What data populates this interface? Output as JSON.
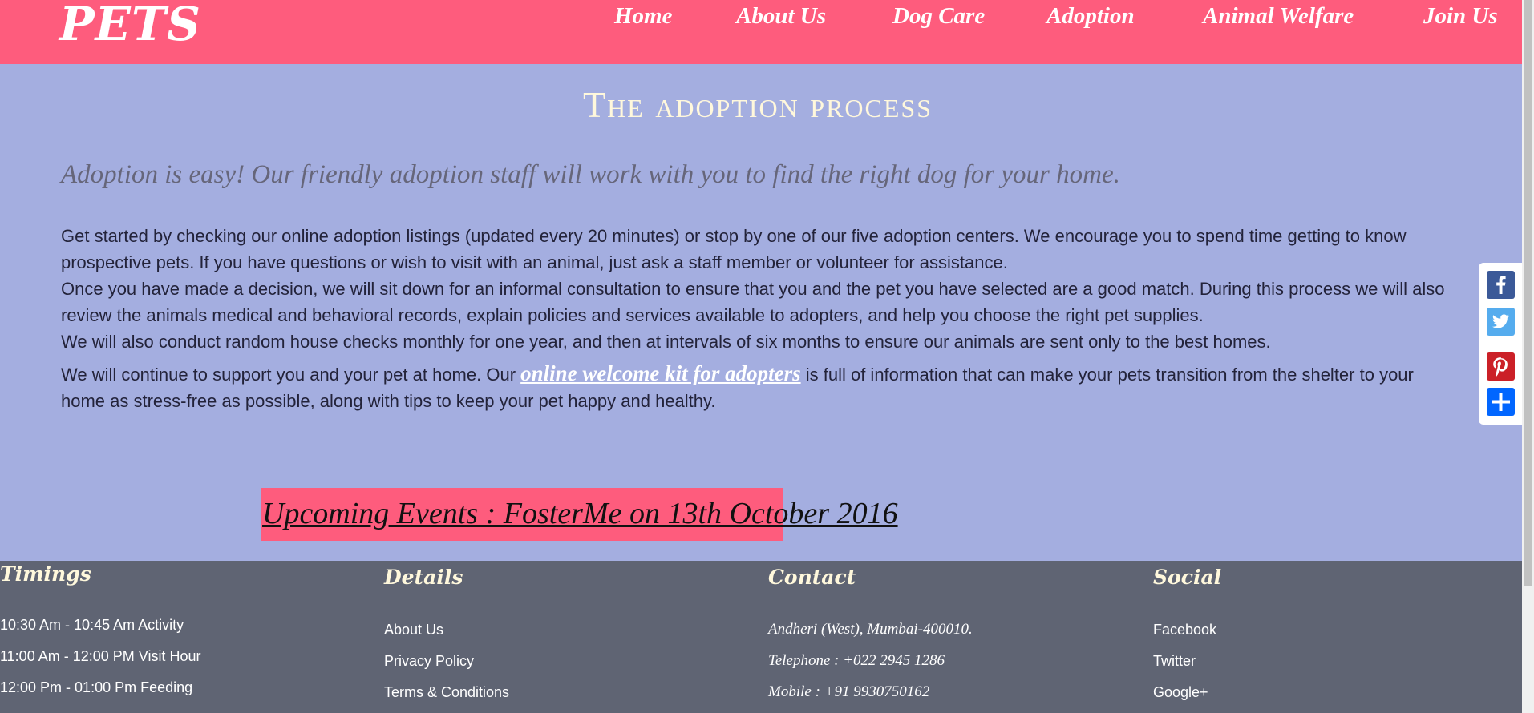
{
  "header": {
    "logo": "PETS",
    "nav": [
      "Home",
      "About Us",
      "Dog Care",
      "Adoption",
      "Animal Welfare",
      "Join Us"
    ]
  },
  "main": {
    "title": "The adoption process",
    "lead": "Adoption is easy! Our friendly adoption staff will work with you to find the right dog for your home.",
    "para1_line1": "Get started by checking our online adoption listings (updated every 20 minutes) or stop by one of our five adoption centers. We encourage you to spend time getting to know prospective pets. If you have questions or wish to visit with an animal, just ask a staff member or volunteer for assistance.",
    "para1_line2": "Once you have made a decision, we will sit down for an informal consultation to ensure that you and the pet you have selected are a good match. During this process we will also review the animals medical and behavioral records, explain policies and services available to adopters, and help you choose the right pet supplies.",
    "para1_line3": "We will also conduct random house checks monthly for one year, and then at intervals of six months to ensure our animals are sent only to the best homes.",
    "para2_before": "We will continue to support you and your pet at home. Our ",
    "para2_link": "online welcome kit for adopters",
    "para2_after": " is full of information that can make your pets transition from the shelter to your home as stress-free as possible, along with tips to keep your pet happy and healthy.",
    "events": "Upcoming Events : FosterMe on 13th October 2016"
  },
  "share": {
    "icons": [
      "facebook-icon",
      "twitter-icon",
      "pinterest-icon",
      "share-plus-icon"
    ],
    "colors": {
      "facebook": "#3b5998",
      "twitter": "#55acee",
      "pinterest": "#cb2027",
      "share": "#0166ff"
    }
  },
  "footer": {
    "timings": {
      "heading": "Timings",
      "items": [
        "10:30 Am - 10:45 Am Activity",
        "11:00 Am - 12:00 PM Visit Hour",
        "12:00 Pm - 01:00 Pm Feeding"
      ]
    },
    "details": {
      "heading": "Details",
      "items": [
        "About Us",
        "Privacy Policy",
        "Terms & Conditions"
      ]
    },
    "contact": {
      "heading": "Contact",
      "items": [
        "Andheri (West), Mumbai-400010.",
        "Telephone : +022 2945 1286",
        "Mobile : +91 9930750162"
      ]
    },
    "social": {
      "heading": "Social",
      "items": [
        "Facebook",
        "Twitter",
        "Google+"
      ]
    }
  },
  "colors": {
    "header": "#fe5c7d",
    "background": "#a4aee0",
    "footer": "#5f6473",
    "title": "#fff8dc"
  }
}
